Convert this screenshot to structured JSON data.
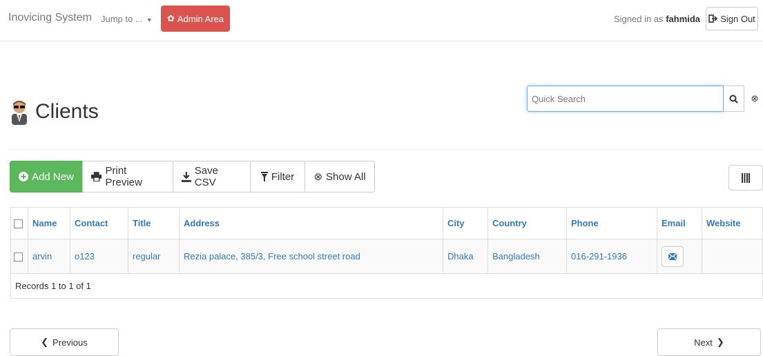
{
  "nav": {
    "brand": "Inovicing System",
    "jump_to": "Jump to ...",
    "admin_area": "Admin Area",
    "signed_in_prefix": "Signed in as",
    "username": "fahmida",
    "sign_out": "Sign Out",
    "admin_color": "#d9534f"
  },
  "page": {
    "title": "Clients",
    "title_icon": "person-icon"
  },
  "search": {
    "placeholder": "Quick Search",
    "value": ""
  },
  "toolbar": {
    "add_new": "Add New",
    "print_preview": "Print Preview",
    "save_csv": "Save CSV",
    "filter": "Filter",
    "show_all": "Show All",
    "add_color": "#5cb85c"
  },
  "table": {
    "headers": [
      "Name",
      "Contact",
      "Title",
      "Address",
      "City",
      "Country",
      "Phone",
      "Email",
      "Website"
    ],
    "rows": [
      [
        "arvin",
        "o123",
        "regular",
        "Rezia palace, 385/3, Free school street road",
        "Dhaka",
        "Bangladesh",
        "016-291-1936",
        "",
        ""
      ]
    ],
    "footer": "Records 1 to 1 of 1",
    "link_color": "#337ab7"
  },
  "pager": {
    "previous": "Previous",
    "next": "Next"
  }
}
